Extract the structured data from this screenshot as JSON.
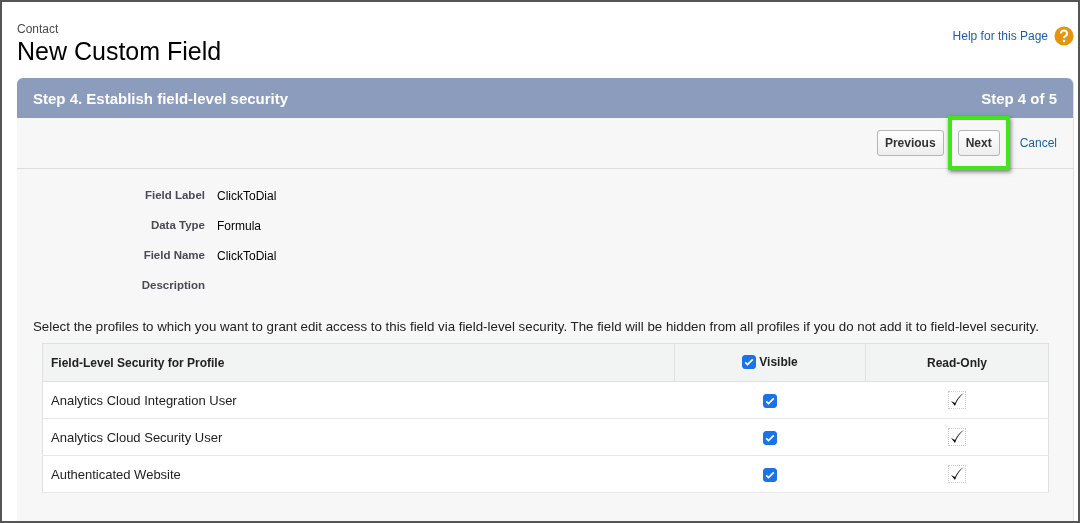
{
  "header": {
    "object": "Contact",
    "title": "New Custom Field",
    "help_link": "Help for this Page"
  },
  "step": {
    "title": "Step 4. Establish field-level security",
    "progress": "Step 4 of 5"
  },
  "buttons": [
    {
      "label": "Previous",
      "highlighted": false
    },
    {
      "label": "Next",
      "highlighted": true
    }
  ],
  "cancel_link": "Cancel",
  "details": [
    {
      "label": "Field Label",
      "value": "ClickToDial"
    },
    {
      "label": "Data Type",
      "value": "Formula"
    },
    {
      "label": "Field Name",
      "value": "ClickToDial"
    },
    {
      "label": "Description"
    }
  ],
  "instructions": "Select the profiles to which you want to grant edit access to this field via field-level security. The field will be hidden from all profiles if you do not add it to field-level security.",
  "table": {
    "columns": [
      {
        "label": "Field-Level Security for Profile"
      },
      {
        "label": "Visible",
        "checked": true
      },
      {
        "label": "Read-Only"
      }
    ],
    "rows": [
      {
        "profile": "Analytics Cloud Integration User",
        "visible": true,
        "read_only": true
      },
      {
        "profile": "Analytics Cloud Security User",
        "visible": true,
        "read_only": true
      },
      {
        "profile": "Authenticated Website",
        "visible": true,
        "read_only": true
      }
    ]
  }
}
